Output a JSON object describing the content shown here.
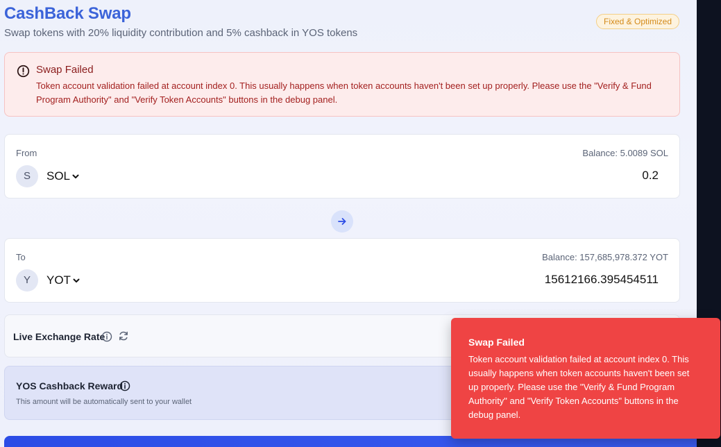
{
  "header": {
    "title": "CashBack Swap",
    "subtitle": "Swap tokens with 20% liquidity contribution and 5% cashback in YOS tokens",
    "badge": "Fixed & Optimized"
  },
  "alert": {
    "icon": "alert-circle-icon",
    "title": "Swap Failed",
    "message": "Token account validation failed at account index 0. This usually happens when token accounts haven't been set up properly. Please use the \"Verify & Fund Program Authority\" and \"Verify Token Accounts\" buttons in the debug panel."
  },
  "from": {
    "label": "From",
    "balance": "Balance: 5.0089 SOL",
    "token_initial": "S",
    "token": "SOL",
    "amount": "0.2"
  },
  "swap_button": {
    "icon": "arrow-right-icon"
  },
  "to": {
    "label": "To",
    "balance": "Balance: 157,685,978.372 YOT",
    "token_initial": "Y",
    "token": "YOT",
    "amount": "15612166.395454511"
  },
  "rate": {
    "label": "Live Exchange Rate",
    "info_icon": "info-icon",
    "refresh_icon": "refresh-icon"
  },
  "reward": {
    "title": "YOS Cashback Reward",
    "info_icon": "info-icon",
    "subtitle": "This amount will be automatically sent to your wallet"
  },
  "toast": {
    "title": "Swap Failed",
    "message": "Token account validation failed at account index 0. This usually happens when token accounts haven't been set up properly. Please use the \"Verify & Fund Program Authority\" and \"Verify Token Accounts\" buttons in the debug panel."
  },
  "colors": {
    "accent": "#3b63d9",
    "error": "#ef4444",
    "submit": "#2b4ce6"
  }
}
